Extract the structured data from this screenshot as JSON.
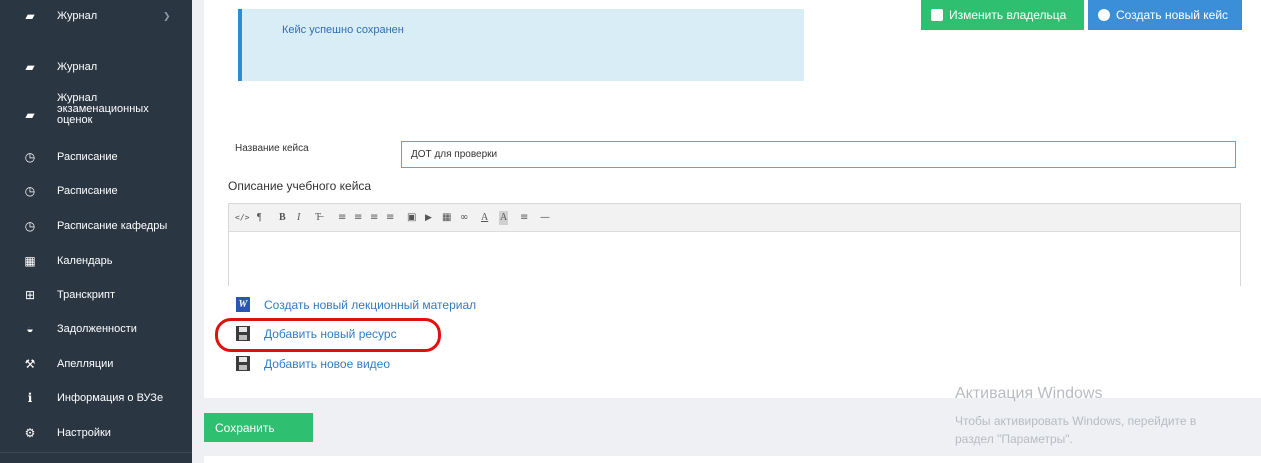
{
  "sidebar": {
    "items": [
      {
        "label": "Журнал",
        "icon": "book-icon",
        "glyph": "▰",
        "has_chevron": true
      },
      {
        "label": "Журнал",
        "icon": "book-icon",
        "glyph": "▰"
      },
      {
        "label": "Журнал экзаменационных оценок",
        "icon": "book-icon",
        "glyph": "▰"
      },
      {
        "label": "Расписание",
        "icon": "clock-icon",
        "glyph": "◷"
      },
      {
        "label": "Расписание",
        "icon": "clock-icon",
        "glyph": "◷"
      },
      {
        "label": "Расписание кафедры",
        "icon": "clock-icon",
        "glyph": "◷"
      },
      {
        "label": "Календарь",
        "icon": "calendar-icon",
        "glyph": "▦"
      },
      {
        "label": "Транскрипт",
        "icon": "table-icon",
        "glyph": "⊞"
      },
      {
        "label": "Задолженности",
        "icon": "tray-icon",
        "glyph": "◒"
      },
      {
        "label": "Апелляции",
        "icon": "gavel-icon",
        "glyph": "⚒"
      },
      {
        "label": "Информация о ВУЗе",
        "icon": "info-icon",
        "glyph": "i"
      },
      {
        "label": "Настройки",
        "icon": "gears-icon",
        "glyph": "⚙"
      }
    ]
  },
  "top_buttons": {
    "change_owner": "Изменить владельца",
    "create_case": "Создать новый кейс"
  },
  "alert": {
    "message": "Кейс успешно сохранен"
  },
  "form": {
    "name_label": "Название кейса",
    "name_value": "ДОТ для проверки",
    "description_label": "Описание учебного кейса"
  },
  "editor_toolbar": [
    "</>",
    "¶",
    "B",
    "I",
    "T̶",
    "≡",
    "≡",
    "≡",
    "≡",
    "▣",
    "▶",
    "▦",
    "∞",
    "A",
    "A",
    "≡",
    "—"
  ],
  "links": {
    "lecture": "Создать новый лекционный материал",
    "resource": "Добавить новый ресурс",
    "video": "Добавить новое видео"
  },
  "save_label": "Сохранить",
  "watermark": {
    "title": "Активация Windows",
    "line1": "Чтобы активировать Windows, перейдите в",
    "line2": "раздел \"Параметры\"."
  },
  "colors": {
    "sidebar_bg": "#2b3643",
    "accent_green": "#2fbf71",
    "accent_blue": "#3b8ed8",
    "link_blue": "#2f7cc5",
    "highlight_red": "#e01010"
  }
}
